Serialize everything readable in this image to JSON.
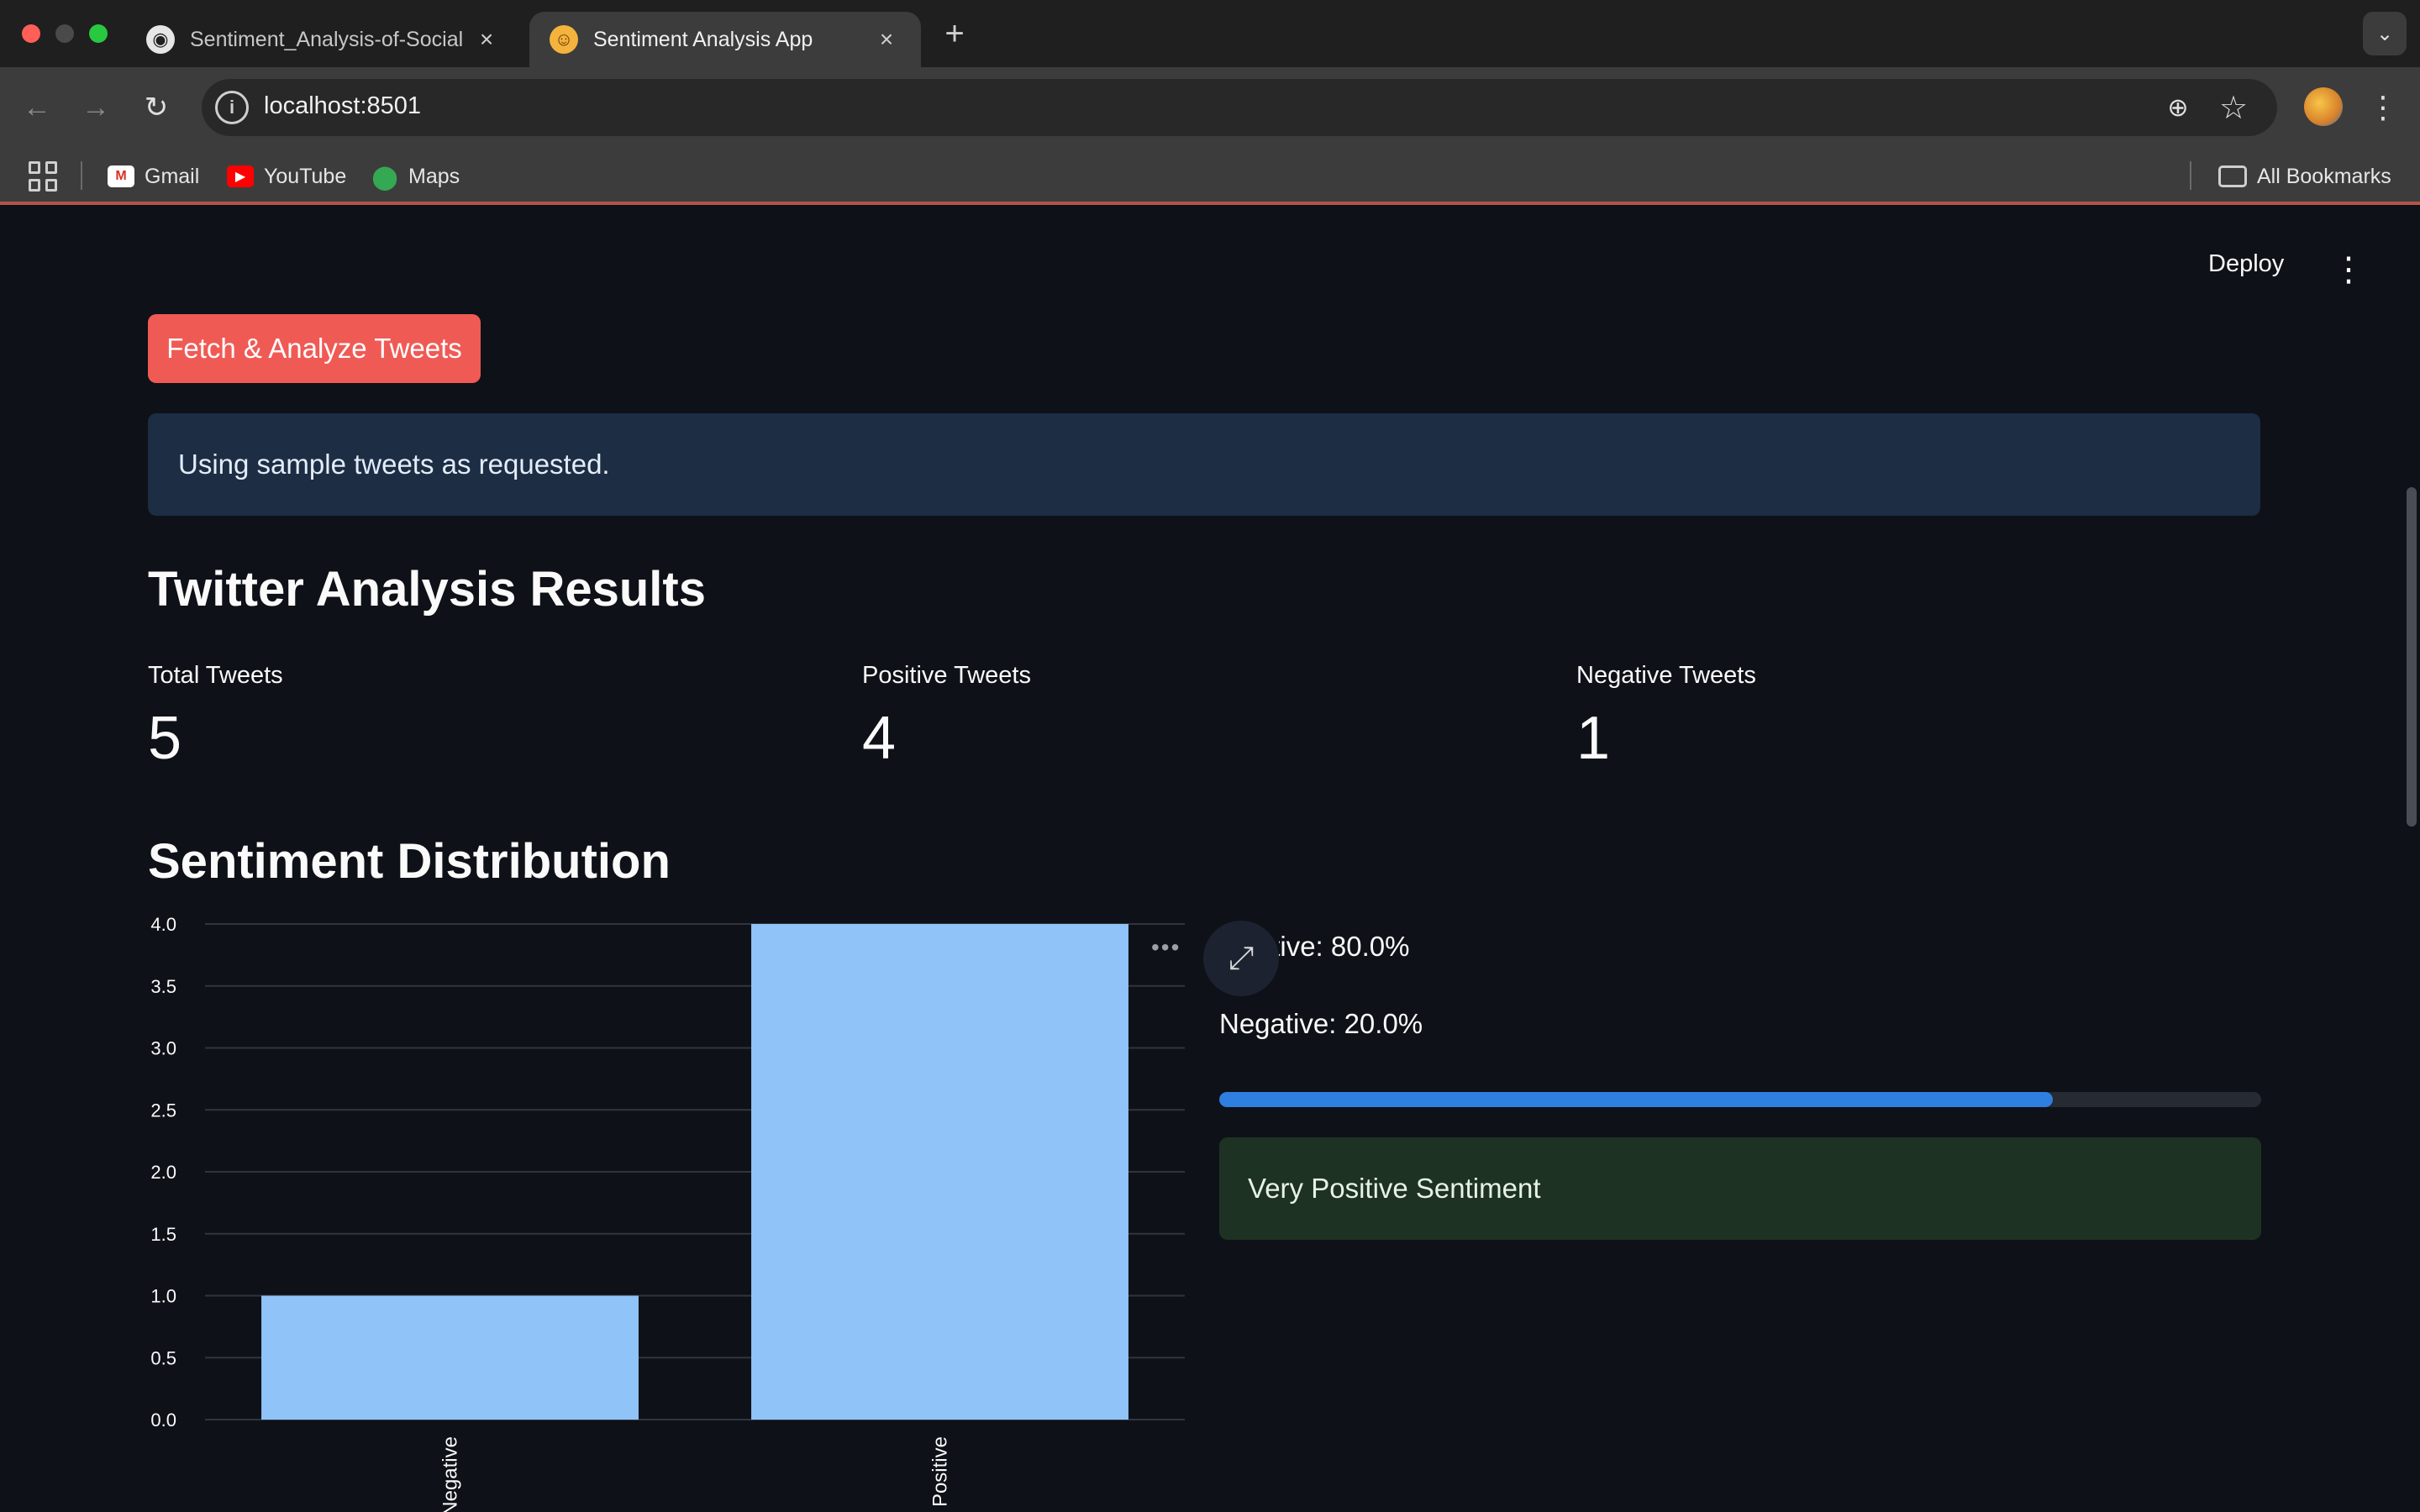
{
  "browser": {
    "tabs": [
      {
        "title": "Sentiment_Analysis-of-Social",
        "favicon": "github-icon",
        "active": false
      },
      {
        "title": "Sentiment Analysis App",
        "favicon": "smiley-icon",
        "active": true
      }
    ],
    "url": "localhost:8501",
    "bookmarks": [
      {
        "label": "Gmail",
        "icon": "gmail-icon"
      },
      {
        "label": "YouTube",
        "icon": "youtube-icon"
      },
      {
        "label": "Maps",
        "icon": "maps-icon"
      }
    ],
    "all_bookmarks_label": "All Bookmarks"
  },
  "app": {
    "deploy_label": "Deploy",
    "fetch_button_label": "Fetch & Analyze Tweets",
    "info_message": "Using sample tweets as requested.",
    "results_heading": "Twitter Analysis Results",
    "metrics": [
      {
        "label": "Total Tweets",
        "value": "5"
      },
      {
        "label": "Positive Tweets",
        "value": "4"
      },
      {
        "label": "Negative Tweets",
        "value": "1"
      }
    ],
    "distribution_heading": "Sentiment Distribution",
    "positive_text": "Positive: 80.0%",
    "negative_text": "Negative: 20.0%",
    "positive_fraction": 0.8,
    "success_message": "Very Positive Sentiment",
    "colors": {
      "primary_button": "#f05a55",
      "bar": "#90c4f9",
      "progress": "#2f7fe0",
      "background": "#0e1117"
    }
  },
  "chart_data": {
    "type": "bar",
    "categories": [
      "Negative",
      "Positive"
    ],
    "values": [
      1,
      4
    ],
    "ylim": [
      0,
      4
    ],
    "yticks": [
      "0.0",
      "0.5",
      "1.0",
      "1.5",
      "2.0",
      "2.5",
      "3.0",
      "3.5",
      "4.0"
    ],
    "grid": true
  }
}
